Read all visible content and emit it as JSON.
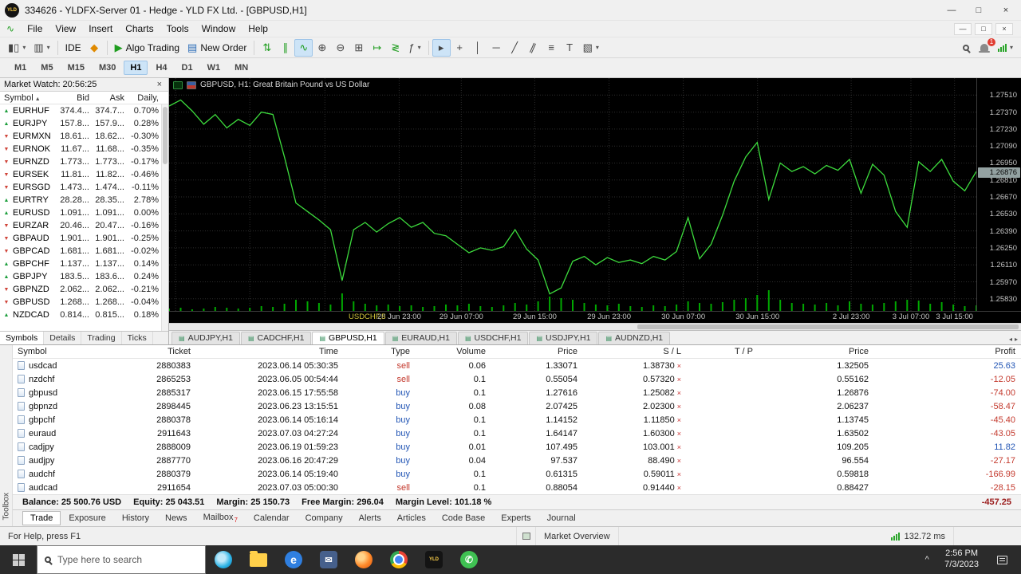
{
  "window": {
    "logo_text": "YLD",
    "title": "334626 - YLDFX-Server 01 - Hedge - YLD FX Ltd. - [GBPUSD,H1]"
  },
  "menu": {
    "items": [
      "File",
      "View",
      "Insert",
      "Charts",
      "Tools",
      "Window",
      "Help"
    ]
  },
  "toolbar": {
    "ide_label": "IDE",
    "algo_trading_label": "Algo Trading",
    "new_order_label": "New Order",
    "notification_count": "1"
  },
  "timeframes": {
    "items": [
      "M1",
      "M5",
      "M15",
      "M30",
      "H1",
      "H4",
      "D1",
      "W1",
      "MN"
    ],
    "active": "H1"
  },
  "market_watch": {
    "title": "Market Watch: 20:56:25",
    "columns": [
      "Symbol",
      "Bid",
      "Ask",
      "Daily,"
    ],
    "rows": [
      {
        "symbol": "EURHUF",
        "bid": "374.4...",
        "ask": "374.7...",
        "daily": "0.70%",
        "dir": "up"
      },
      {
        "symbol": "EURJPY",
        "bid": "157.8...",
        "ask": "157.9...",
        "daily": "0.28%",
        "dir": "up"
      },
      {
        "symbol": "EURMXN",
        "bid": "18.61...",
        "ask": "18.62...",
        "daily": "-0.30%",
        "dir": "down"
      },
      {
        "symbol": "EURNOK",
        "bid": "11.67...",
        "ask": "11.68...",
        "daily": "-0.35%",
        "dir": "down"
      },
      {
        "symbol": "EURNZD",
        "bid": "1.773...",
        "ask": "1.773...",
        "daily": "-0.17%",
        "dir": "down"
      },
      {
        "symbol": "EURSEK",
        "bid": "11.81...",
        "ask": "11.82...",
        "daily": "-0.46%",
        "dir": "down"
      },
      {
        "symbol": "EURSGD",
        "bid": "1.473...",
        "ask": "1.474...",
        "daily": "-0.11%",
        "dir": "down"
      },
      {
        "symbol": "EURTRY",
        "bid": "28.28...",
        "ask": "28.35...",
        "daily": "2.78%",
        "dir": "up"
      },
      {
        "symbol": "EURUSD",
        "bid": "1.091...",
        "ask": "1.091...",
        "daily": "0.00%",
        "dir": "up"
      },
      {
        "symbol": "EURZAR",
        "bid": "20.46...",
        "ask": "20.47...",
        "daily": "-0.16%",
        "dir": "down"
      },
      {
        "symbol": "GBPAUD",
        "bid": "1.901...",
        "ask": "1.901...",
        "daily": "-0.25%",
        "dir": "down"
      },
      {
        "symbol": "GBPCAD",
        "bid": "1.681...",
        "ask": "1.681...",
        "daily": "-0.02%",
        "dir": "down"
      },
      {
        "symbol": "GBPCHF",
        "bid": "1.137...",
        "ask": "1.137...",
        "daily": "0.14%",
        "dir": "up"
      },
      {
        "symbol": "GBPJPY",
        "bid": "183.5...",
        "ask": "183.6...",
        "daily": "0.24%",
        "dir": "up"
      },
      {
        "symbol": "GBPNZD",
        "bid": "2.062...",
        "ask": "2.062...",
        "daily": "-0.21%",
        "dir": "down"
      },
      {
        "symbol": "GBPUSD",
        "bid": "1.268...",
        "ask": "1.268...",
        "daily": "-0.04%",
        "dir": "down"
      },
      {
        "symbol": "NZDCAD",
        "bid": "0.814...",
        "ask": "0.815...",
        "daily": "0.18%",
        "dir": "up"
      }
    ],
    "tabs": [
      "Symbols",
      "Details",
      "Trading",
      "Ticks"
    ],
    "active_tab": "Symbols"
  },
  "chart_tabs": {
    "items": [
      "AUDJPY,H1",
      "CADCHF,H1",
      "GBPUSD,H1",
      "EURAUD,H1",
      "USDCHF,H1",
      "USDJPY,H1",
      "AUDNZD,H1"
    ],
    "active": "GBPUSD,H1"
  },
  "chart_data": {
    "type": "line",
    "title": "GBPUSD, H1:  Great Britain Pound vs US Dollar",
    "symbol": "GBPUSD",
    "timeframe": "H1",
    "overlay_label": "USDCHF,5",
    "current_price": "1.26876",
    "line_color": "#3ddc3d",
    "background": "#000000",
    "grid": true,
    "ylim": [
      1.2573,
      1.2765
    ],
    "yticks": [
      "1.27510",
      "1.27370",
      "1.27230",
      "1.27090",
      "1.26950",
      "1.26810",
      "1.26670",
      "1.26530",
      "1.26390",
      "1.26250",
      "1.26110",
      "1.25970",
      "1.25830"
    ],
    "xticks": [
      "28 Jun 23:00",
      "29 Jun 07:00",
      "29 Jun 15:00",
      "29 Jun 23:00",
      "30 Jun 07:00",
      "30 Jun 15:00",
      "2 Jul 23:00",
      "3 Jul 07:00",
      "3 Jul 15:00"
    ],
    "xtick_pos": [
      0.285,
      0.362,
      0.453,
      0.545,
      0.637,
      0.729,
      0.845,
      0.919,
      0.973
    ],
    "extra_grid_pos": [
      0.008,
      0.1,
      0.193
    ],
    "prices": [
      1.2742,
      1.2747,
      1.2738,
      1.2727,
      1.2735,
      1.2724,
      1.2731,
      1.2726,
      1.2737,
      1.2735,
      1.27,
      1.2662,
      1.2655,
      1.2648,
      1.264,
      1.2598,
      1.264,
      1.2646,
      1.2638,
      1.2645,
      1.265,
      1.2642,
      1.2646,
      1.2637,
      1.2635,
      1.2628,
      1.2621,
      1.2625,
      1.2623,
      1.2626,
      1.264,
      1.2624,
      1.2615,
      1.2587,
      1.2592,
      1.2614,
      1.2618,
      1.2611,
      1.2617,
      1.2613,
      1.2615,
      1.2612,
      1.2618,
      1.2615,
      1.2622,
      1.265,
      1.2616,
      1.2628,
      1.2652,
      1.268,
      1.27,
      1.2712,
      1.2665,
      1.2695,
      1.2688,
      1.2692,
      1.2686,
      1.2693,
      1.2689,
      1.2698,
      1.267,
      1.2694,
      1.2685,
      1.2655,
      1.2642,
      1.2696,
      1.2688,
      1.2698,
      1.268,
      1.2672,
      1.2688
    ],
    "volumes": [
      3,
      4,
      2,
      3,
      5,
      4,
      3,
      4,
      6,
      5,
      9,
      14,
      12,
      10,
      8,
      22,
      12,
      9,
      7,
      8,
      6,
      7,
      5,
      6,
      8,
      7,
      9,
      6,
      5,
      7,
      10,
      8,
      12,
      18,
      16,
      14,
      10,
      8,
      7,
      9,
      6,
      5,
      7,
      6,
      8,
      12,
      10,
      9,
      11,
      14,
      16,
      20,
      26,
      14,
      10,
      9,
      8,
      10,
      7,
      12,
      9,
      8,
      10,
      12,
      14,
      13,
      9,
      11,
      8,
      6,
      7
    ]
  },
  "trade": {
    "columns": [
      "Symbol",
      "Ticket",
      "Time",
      "Type",
      "Volume",
      "Price",
      "S / L",
      "T / P",
      "Price",
      "Profit"
    ],
    "rows": [
      {
        "symbol": "usdcad",
        "ticket": "2880383",
        "time": "2023.06.14 05:30:35",
        "type": "sell",
        "volume": "0.06",
        "price": "1.33071",
        "sl": "1.38730",
        "tp": "",
        "price2": "1.32505",
        "profit": "25.63"
      },
      {
        "symbol": "nzdchf",
        "ticket": "2865253",
        "time": "2023.06.05 00:54:44",
        "type": "sell",
        "volume": "0.1",
        "price": "0.55054",
        "sl": "0.57320",
        "tp": "",
        "price2": "0.55162",
        "profit": "-12.05"
      },
      {
        "symbol": "gbpusd",
        "ticket": "2885317",
        "time": "2023.06.15 17:55:58",
        "type": "buy",
        "volume": "0.1",
        "price": "1.27616",
        "sl": "1.25082",
        "tp": "",
        "price2": "1.26876",
        "profit": "-74.00"
      },
      {
        "symbol": "gbpnzd",
        "ticket": "2898445",
        "time": "2023.06.23 13:15:51",
        "type": "buy",
        "volume": "0.08",
        "price": "2.07425",
        "sl": "2.02300",
        "tp": "",
        "price2": "2.06237",
        "profit": "-58.47"
      },
      {
        "symbol": "gbpchf",
        "ticket": "2880378",
        "time": "2023.06.14 05:16:14",
        "type": "buy",
        "volume": "0.1",
        "price": "1.14152",
        "sl": "1.11850",
        "tp": "",
        "price2": "1.13745",
        "profit": "-45.40"
      },
      {
        "symbol": "euraud",
        "ticket": "2911643",
        "time": "2023.07.03 04:27:24",
        "type": "buy",
        "volume": "0.1",
        "price": "1.64147",
        "sl": "1.60300",
        "tp": "",
        "price2": "1.63502",
        "profit": "-43.05"
      },
      {
        "symbol": "cadjpy",
        "ticket": "2888009",
        "time": "2023.06.19 01:59:23",
        "type": "buy",
        "volume": "0.01",
        "price": "107.495",
        "sl": "103.001",
        "tp": "",
        "price2": "109.205",
        "profit": "11.82"
      },
      {
        "symbol": "audjpy",
        "ticket": "2887770",
        "time": "2023.06.16 20:47:29",
        "type": "buy",
        "volume": "0.04",
        "price": "97.537",
        "sl": "88.490",
        "tp": "",
        "price2": "96.554",
        "profit": "-27.17"
      },
      {
        "symbol": "audchf",
        "ticket": "2880379",
        "time": "2023.06.14 05:19:40",
        "type": "buy",
        "volume": "0.1",
        "price": "0.61315",
        "sl": "0.59011",
        "tp": "",
        "price2": "0.59818",
        "profit": "-166.99"
      },
      {
        "symbol": "audcad",
        "ticket": "2911654",
        "time": "2023.07.03 05:00:30",
        "type": "sell",
        "volume": "0.1",
        "price": "0.88054",
        "sl": "0.91440",
        "tp": "",
        "price2": "0.88427",
        "profit": "-28.15"
      }
    ]
  },
  "account": {
    "balance": "Balance: 25 500.76 USD",
    "equity": "Equity: 25 043.51",
    "margin": "Margin: 25 150.73",
    "free_margin": "Free Margin: 296.04",
    "margin_level": "Margin Level: 101.18 %",
    "floating_pl": "-457.25"
  },
  "toolbox": {
    "label": "Toolbox",
    "tabs": [
      "Trade",
      "Exposure",
      "History",
      "News",
      "Mailbox",
      "Calendar",
      "Company",
      "Alerts",
      "Articles",
      "Code Base",
      "Experts",
      "Journal"
    ],
    "active_tab": "Trade",
    "mailbox_badge": "7"
  },
  "status_bar": {
    "help": "For Help, press F1",
    "overview": "Market Overview",
    "ping": "132.72 ms"
  },
  "taskbar": {
    "search_placeholder": "Type here to search",
    "apps": [
      {
        "id": "cortana"
      },
      {
        "id": "file-explorer",
        "color": "#ffd04a"
      },
      {
        "id": "edge",
        "color": "#2f7fe0"
      },
      {
        "id": "mail",
        "color": "#46608c"
      },
      {
        "id": "firefox"
      },
      {
        "id": "chrome"
      },
      {
        "id": "yld-fx",
        "color": "#141414"
      },
      {
        "id": "whatsapp",
        "color": "#3fc152"
      }
    ],
    "time": "2:56 PM",
    "date": "7/3/2023"
  }
}
